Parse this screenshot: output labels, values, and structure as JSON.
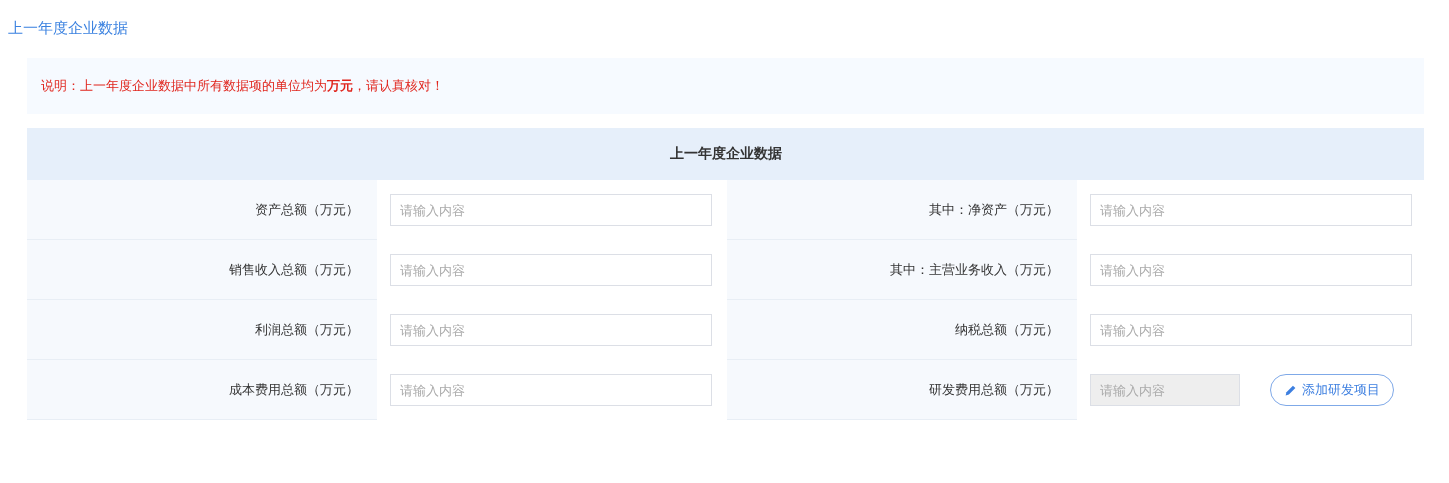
{
  "page_title": "上一年度企业数据",
  "notice": "说明：上一年度企业数据中所有数据项的单位均为**万元**，请认真核对！",
  "table": {
    "header": "上一年度企业数据",
    "fields": [
      {
        "label": "资产总额（万元）",
        "placeholder": "请输入内容",
        "disabled": false
      },
      {
        "label": "其中：净资产（万元）",
        "placeholder": "请输入内容",
        "disabled": false
      },
      {
        "label": "销售收入总额（万元）",
        "placeholder": "请输入内容",
        "disabled": false
      },
      {
        "label": "其中：主营业务收入（万元）",
        "placeholder": "请输入内容",
        "disabled": false
      },
      {
        "label": "利润总额（万元）",
        "placeholder": "请输入内容",
        "disabled": false
      },
      {
        "label": "纳税总额（万元）",
        "placeholder": "请输入内容",
        "disabled": false
      },
      {
        "label": "成本费用总额（万元）",
        "placeholder": "请输入内容",
        "disabled": false
      },
      {
        "label": "研发费用总额（万元）",
        "placeholder": "请输入内容",
        "disabled": true,
        "button": "添加研发项目"
      }
    ]
  }
}
